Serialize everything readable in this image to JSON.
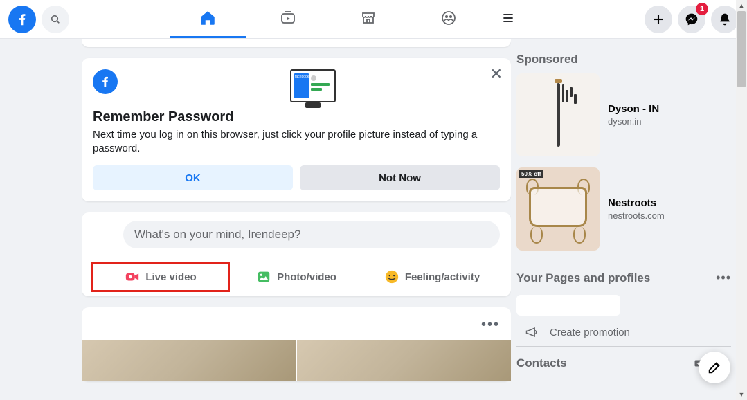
{
  "topbar": {
    "messenger_badge": "1"
  },
  "remember_password": {
    "title": "Remember Password",
    "body": "Next time you log in on this browser, just click your profile picture instead of typing a password.",
    "ok_label": "OK",
    "not_now_label": "Not Now"
  },
  "composer": {
    "placeholder": "What's on your mind, Irendeep?",
    "live_video": "Live video",
    "photo_video": "Photo/video",
    "feeling_activity": "Feeling/activity"
  },
  "right": {
    "sponsored_title": "Sponsored",
    "sponsors": [
      {
        "name": "Dyson - IN",
        "url": "dyson.in"
      },
      {
        "name": "Nestroots",
        "url": "nestroots.com",
        "badge": "50% off"
      }
    ],
    "pages_title": "Your Pages and profiles",
    "create_promotion": "Create promotion",
    "contacts_title": "Contacts"
  }
}
